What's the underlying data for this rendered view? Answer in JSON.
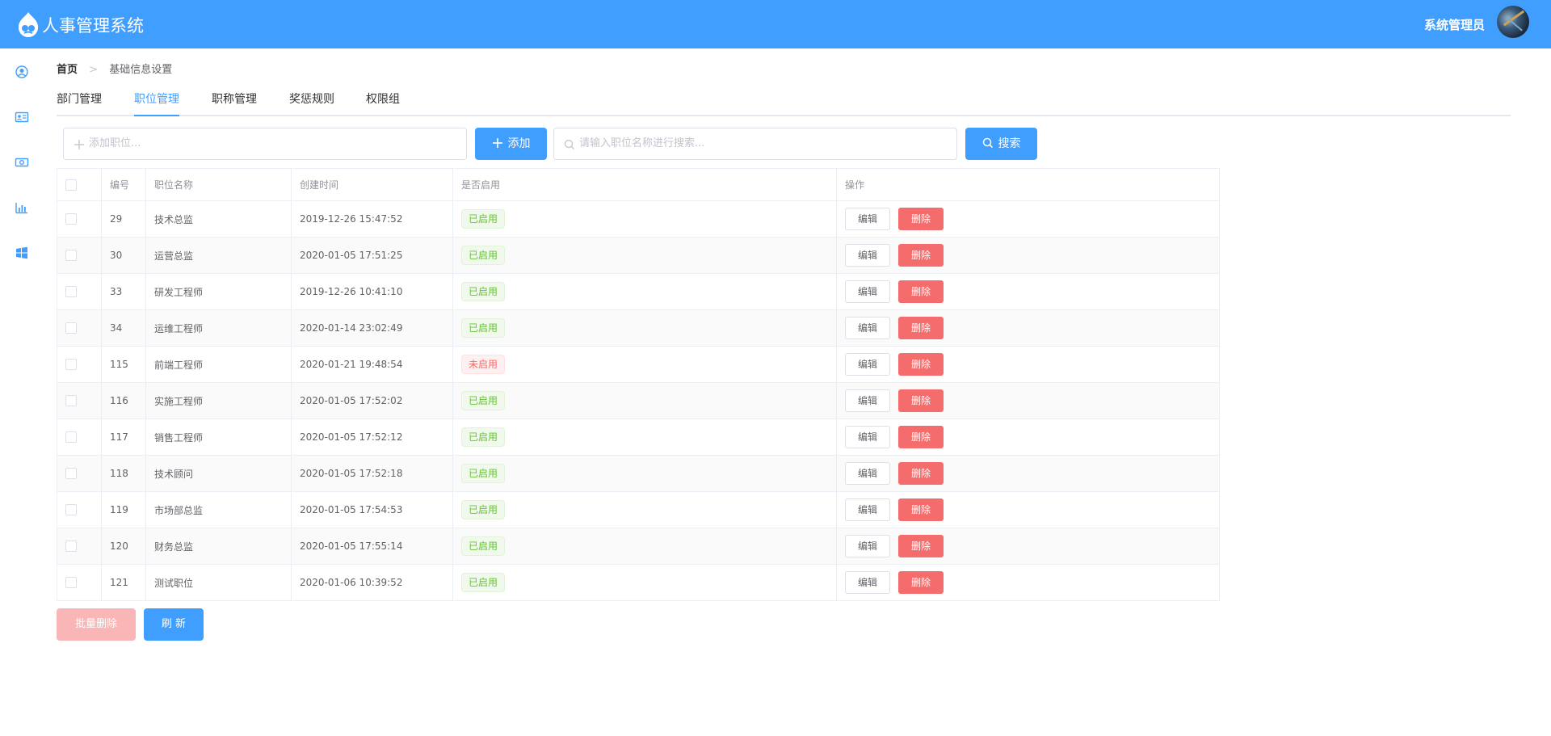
{
  "header": {
    "title": "人事管理系统",
    "user_name": "系统管理员",
    "background_color": "#409eff"
  },
  "sidebar": {
    "icons": [
      "user-circle-icon",
      "id-card-icon",
      "money-icon",
      "bar-chart-icon",
      "windows-icon"
    ]
  },
  "breadcrumb": {
    "home": "首页",
    "separator": ">",
    "current": "基础信息设置"
  },
  "tabs": [
    {
      "label": "部门管理",
      "active": false
    },
    {
      "label": "职位管理",
      "active": true
    },
    {
      "label": "职称管理",
      "active": false
    },
    {
      "label": "奖惩规则",
      "active": false
    },
    {
      "label": "权限组",
      "active": false
    }
  ],
  "toolbar": {
    "add_placeholder": "添加职位...",
    "add_button": "添加",
    "search_placeholder": "请输入职位名称进行搜索...",
    "search_button": "搜索"
  },
  "table": {
    "headers": [
      "编号",
      "职位名称",
      "创建时间",
      "是否启用",
      "操作"
    ],
    "edit_label": "编辑",
    "delete_label": "删除",
    "rows": [
      {
        "id": "29",
        "name": "技术总监",
        "created": "2019-12-26 15:47:52",
        "status": "已启用",
        "enabled": true
      },
      {
        "id": "30",
        "name": "运营总监",
        "created": "2020-01-05 17:51:25",
        "status": "已启用",
        "enabled": true
      },
      {
        "id": "33",
        "name": "研发工程师",
        "created": "2019-12-26 10:41:10",
        "status": "已启用",
        "enabled": true
      },
      {
        "id": "34",
        "name": "运维工程师",
        "created": "2020-01-14 23:02:49",
        "status": "已启用",
        "enabled": true
      },
      {
        "id": "115",
        "name": "前端工程师",
        "created": "2020-01-21 19:48:54",
        "status": "未启用",
        "enabled": false
      },
      {
        "id": "116",
        "name": "实施工程师",
        "created": "2020-01-05 17:52:02",
        "status": "已启用",
        "enabled": true
      },
      {
        "id": "117",
        "name": "销售工程师",
        "created": "2020-01-05 17:52:12",
        "status": "已启用",
        "enabled": true
      },
      {
        "id": "118",
        "name": "技术顾问",
        "created": "2020-01-05 17:52:18",
        "status": "已启用",
        "enabled": true
      },
      {
        "id": "119",
        "name": "市场部总监",
        "created": "2020-01-05 17:54:53",
        "status": "已启用",
        "enabled": true
      },
      {
        "id": "120",
        "name": "财务总监",
        "created": "2020-01-05 17:55:14",
        "status": "已启用",
        "enabled": true
      },
      {
        "id": "121",
        "name": "测试职位",
        "created": "2020-01-06 10:39:52",
        "status": "已启用",
        "enabled": true
      }
    ]
  },
  "footer": {
    "batch_delete": "批量删除",
    "refresh": "刷 新"
  }
}
